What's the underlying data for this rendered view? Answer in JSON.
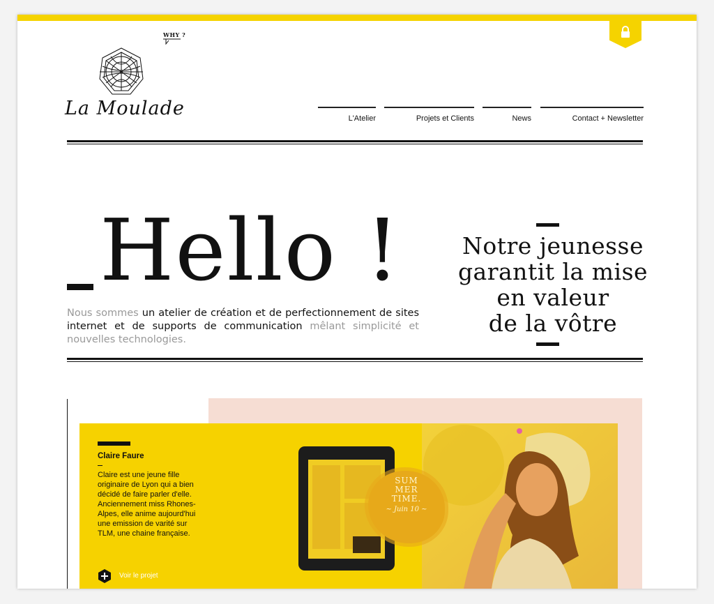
{
  "header": {
    "why_label": "WHY ?",
    "logo_text": "La Moulade"
  },
  "nav": {
    "items": [
      "L'Atelier",
      "Projets et Clients",
      "News",
      "Contact + Newsletter"
    ]
  },
  "hero": {
    "title": "Hello !",
    "intro_lead": "Nous sommes",
    "intro_main": "un atelier de création et de perfectionnement de sites internet et de supports de communication",
    "intro_tail": "mêlant simplicité et nouvelles technologies.",
    "tagline_lines": [
      "Notre jeunesse",
      "garantit la mise",
      "en valeur",
      "de la vôtre"
    ]
  },
  "project": {
    "name": "Claire Faure",
    "description": "Claire est une jeune fille originaire de Lyon qui a bien décidé de faire parler d'elle. Anciennement miss Rhones-Alpes, elle anime aujourd'hui une emission de varité sur TLM, une chaine française.",
    "link_label": "Voir le projet",
    "badge_title": "SUM\nMER\nTIME.",
    "badge_date": "~ Juin 10 ~"
  },
  "colors": {
    "accent": "#f5d300",
    "text": "#111111",
    "muted": "#999999",
    "pink": "#f6ddd3"
  },
  "icons": [
    "lock-icon",
    "logo-emblem-icon",
    "speech-bubble-icon",
    "plus-icon"
  ]
}
